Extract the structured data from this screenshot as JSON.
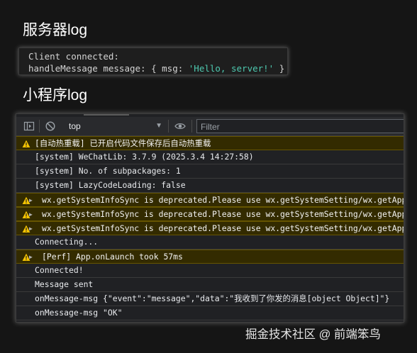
{
  "headings": {
    "server": "服务器log",
    "miniprogram": "小程序log"
  },
  "server_log": {
    "line1": "Client connected:",
    "line2_prefix": "handleMessage message: { msg: ",
    "line2_string": "'Hello, server!'",
    "line2_suffix": " }"
  },
  "console": {
    "toolbar": {
      "context": "top",
      "filter_placeholder": "Filter"
    },
    "rows": [
      {
        "level": "warning",
        "expandable": false,
        "text": "[自动热重载] 已开启代码文件保存后自动热重载"
      },
      {
        "level": "info",
        "expandable": false,
        "text": "[system] WeChatLib: 3.7.9 (2025.3.4 14:27:58)"
      },
      {
        "level": "info",
        "expandable": false,
        "text": "[system] No. of subpackages: 1"
      },
      {
        "level": "info",
        "expandable": false,
        "text": "[system] LazyCodeLoading: false"
      },
      {
        "level": "warning",
        "expandable": true,
        "text": "wx.getSystemInfoSync is deprecated.Please use wx.getSystemSetting/wx.getAppAu"
      },
      {
        "level": "warning",
        "expandable": true,
        "text": "wx.getSystemInfoSync is deprecated.Please use wx.getSystemSetting/wx.getAppAu"
      },
      {
        "level": "warning",
        "expandable": true,
        "text": "wx.getSystemInfoSync is deprecated.Please use wx.getSystemSetting/wx.getAppAu"
      },
      {
        "level": "info",
        "expandable": false,
        "text": "Connecting..."
      },
      {
        "level": "warning",
        "expandable": true,
        "text": "[Perf] App.onLaunch took 57ms"
      },
      {
        "level": "info",
        "expandable": false,
        "text": "Connected!"
      },
      {
        "level": "info",
        "expandable": false,
        "text": "Message sent"
      },
      {
        "level": "info",
        "expandable": false,
        "text": "onMessage-msg {\"event\":\"message\",\"data\":\"我收到了你发的消息[object Object]\"}"
      },
      {
        "level": "info",
        "expandable": false,
        "text": "onMessage-msg \"OK\""
      }
    ]
  },
  "watermark": "掘金技术社区 @ 前端笨鸟",
  "colors": {
    "background": "#151515",
    "warning_bg": "#332b00",
    "warning_icon": "#f5c400",
    "string_literal": "#4ec9b0"
  },
  "icons": [
    "sidebar-toggle-icon",
    "clear-console-icon",
    "chevron-down-icon",
    "eye-icon",
    "warning-icon",
    "expand-triangle-icon"
  ]
}
